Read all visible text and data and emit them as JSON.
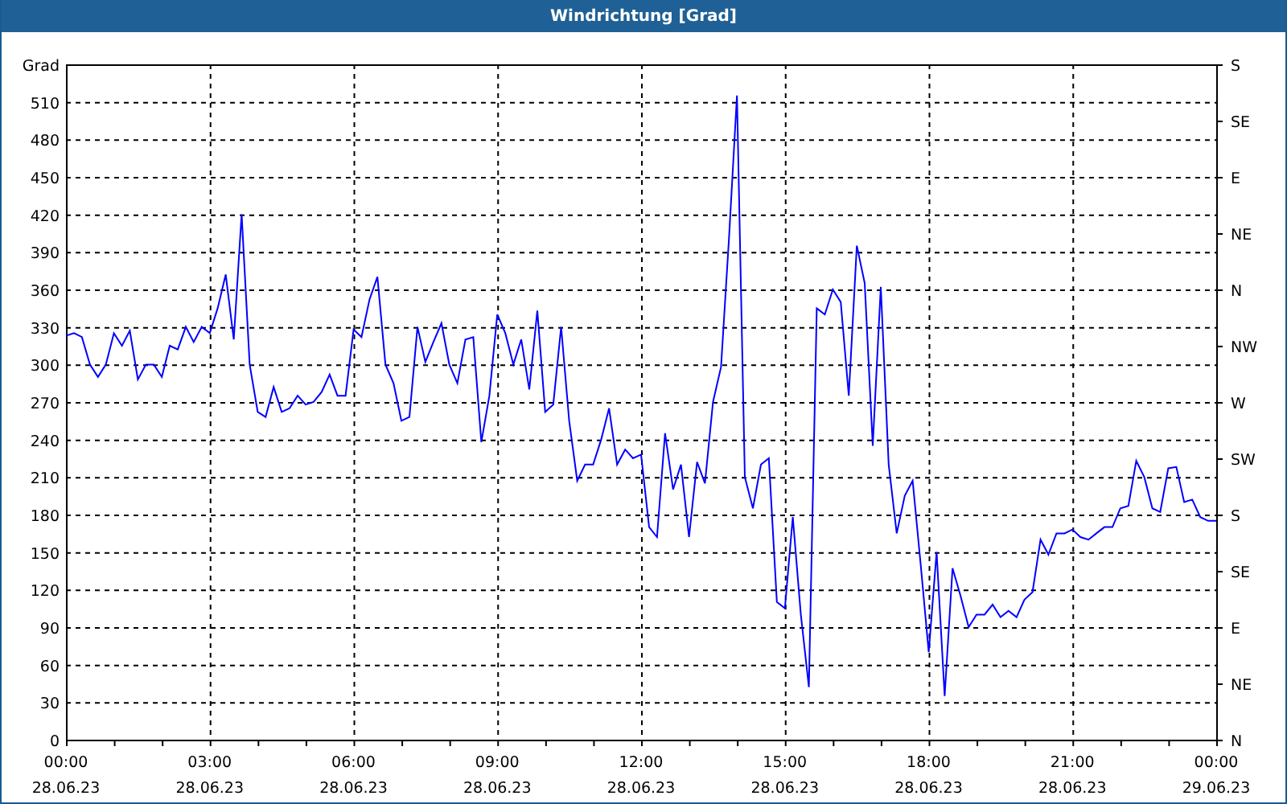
{
  "window": {
    "title": "Windrichtung [Grad]"
  },
  "chart": {
    "chart_data": {
      "type": "line",
      "ylabel": "Grad",
      "grid": true,
      "ylim": [
        0,
        540
      ],
      "yticks": [
        0,
        30,
        60,
        90,
        120,
        150,
        180,
        210,
        240,
        270,
        300,
        330,
        360,
        390,
        420,
        450,
        480,
        510
      ],
      "categories": [
        "00:00\n28.06.23",
        null,
        null,
        null,
        null,
        null,
        null,
        null,
        null,
        null,
        null,
        null,
        null,
        null,
        null,
        null,
        null,
        null,
        "03:00\n28.06.23",
        null,
        null,
        null,
        null,
        null,
        null,
        null,
        null,
        null,
        null,
        null,
        null,
        null,
        null,
        null,
        null,
        null,
        "06:00\n28.06.23",
        null,
        null,
        null,
        null,
        null,
        null,
        null,
        null,
        null,
        null,
        null,
        null,
        null,
        null,
        null,
        null,
        null,
        "09:00\n28.06.23",
        null,
        null,
        null,
        null,
        null,
        null,
        null,
        null,
        null,
        null,
        null,
        null,
        null,
        null,
        null,
        null,
        null,
        "12:00\n28.06.23",
        null,
        null,
        null,
        null,
        null,
        null,
        null,
        null,
        null,
        null,
        null,
        null,
        null,
        null,
        null,
        null,
        null,
        "15:00\n28.06.23",
        null,
        null,
        null,
        null,
        null,
        null,
        null,
        null,
        null,
        null,
        null,
        null,
        null,
        null,
        null,
        null,
        null,
        "18:00\n28.06.23",
        null,
        null,
        null,
        null,
        null,
        null,
        null,
        null,
        null,
        null,
        null,
        null,
        null,
        null,
        null,
        null,
        null,
        "21:00\n28.06.23",
        null,
        null,
        null,
        null,
        null,
        null,
        null,
        null,
        null,
        null,
        null,
        null,
        null,
        null,
        null,
        null,
        null,
        "00:00\n29.06.23"
      ],
      "series": [
        {
          "color": "#0000ff",
          "values": [
            323,
            325,
            322,
            300,
            290,
            300,
            325,
            315,
            327,
            288,
            300,
            300,
            290,
            315,
            312,
            330,
            318,
            330,
            325,
            345,
            372,
            320,
            420,
            300,
            262,
            258,
            282,
            262,
            265,
            275,
            268,
            270,
            278,
            292,
            275,
            275,
            328,
            322,
            352,
            370,
            300,
            285,
            255,
            258,
            330,
            302,
            318,
            333,
            300,
            285,
            320,
            322,
            238,
            275,
            340,
            325,
            300,
            320,
            280,
            343,
            262,
            268,
            330,
            255,
            207,
            220,
            220,
            240,
            265,
            220,
            232,
            225,
            228,
            170,
            162,
            245,
            200,
            220,
            162,
            222,
            205,
            270,
            298,
            400,
            515,
            210,
            185,
            220,
            225,
            110,
            105,
            178,
            100,
            42,
            345,
            340,
            360,
            350,
            275,
            395,
            365,
            235,
            362,
            220,
            165,
            195,
            207,
            140,
            70,
            150,
            35,
            137,
            115,
            90,
            100,
            100,
            108,
            98,
            103,
            98,
            112,
            118,
            160,
            148,
            165,
            165,
            168,
            162,
            160,
            165,
            170,
            170,
            185,
            187,
            223,
            210,
            185,
            182,
            217,
            218,
            190,
            192,
            178,
            175,
            175
          ]
        }
      ]
    },
    "right_axis": {
      "labels": [
        "S",
        "SE",
        "E",
        "NE",
        "N",
        "NW",
        "W",
        "SW",
        "S",
        "SE",
        "E",
        "NE",
        "N"
      ]
    }
  }
}
